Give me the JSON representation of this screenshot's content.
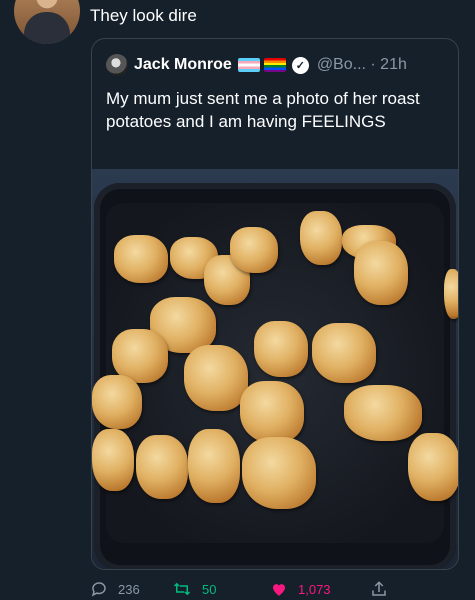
{
  "reply": {
    "text": "They look dire"
  },
  "quote": {
    "name": "Jack Monroe",
    "handle": "@Bo... · 21h",
    "text": "My mum just sent me a photo of her roast potatoes and I am having FEELINGS",
    "photo": "roast-potatoes-photo"
  },
  "actions": {
    "replies": "236",
    "retweets": "50",
    "likes": "1,073"
  },
  "colors": {
    "background": "#15202b",
    "border": "#38444d",
    "muted": "#8b98a5",
    "retweet": "#00ba7c",
    "like": "#f91880"
  }
}
